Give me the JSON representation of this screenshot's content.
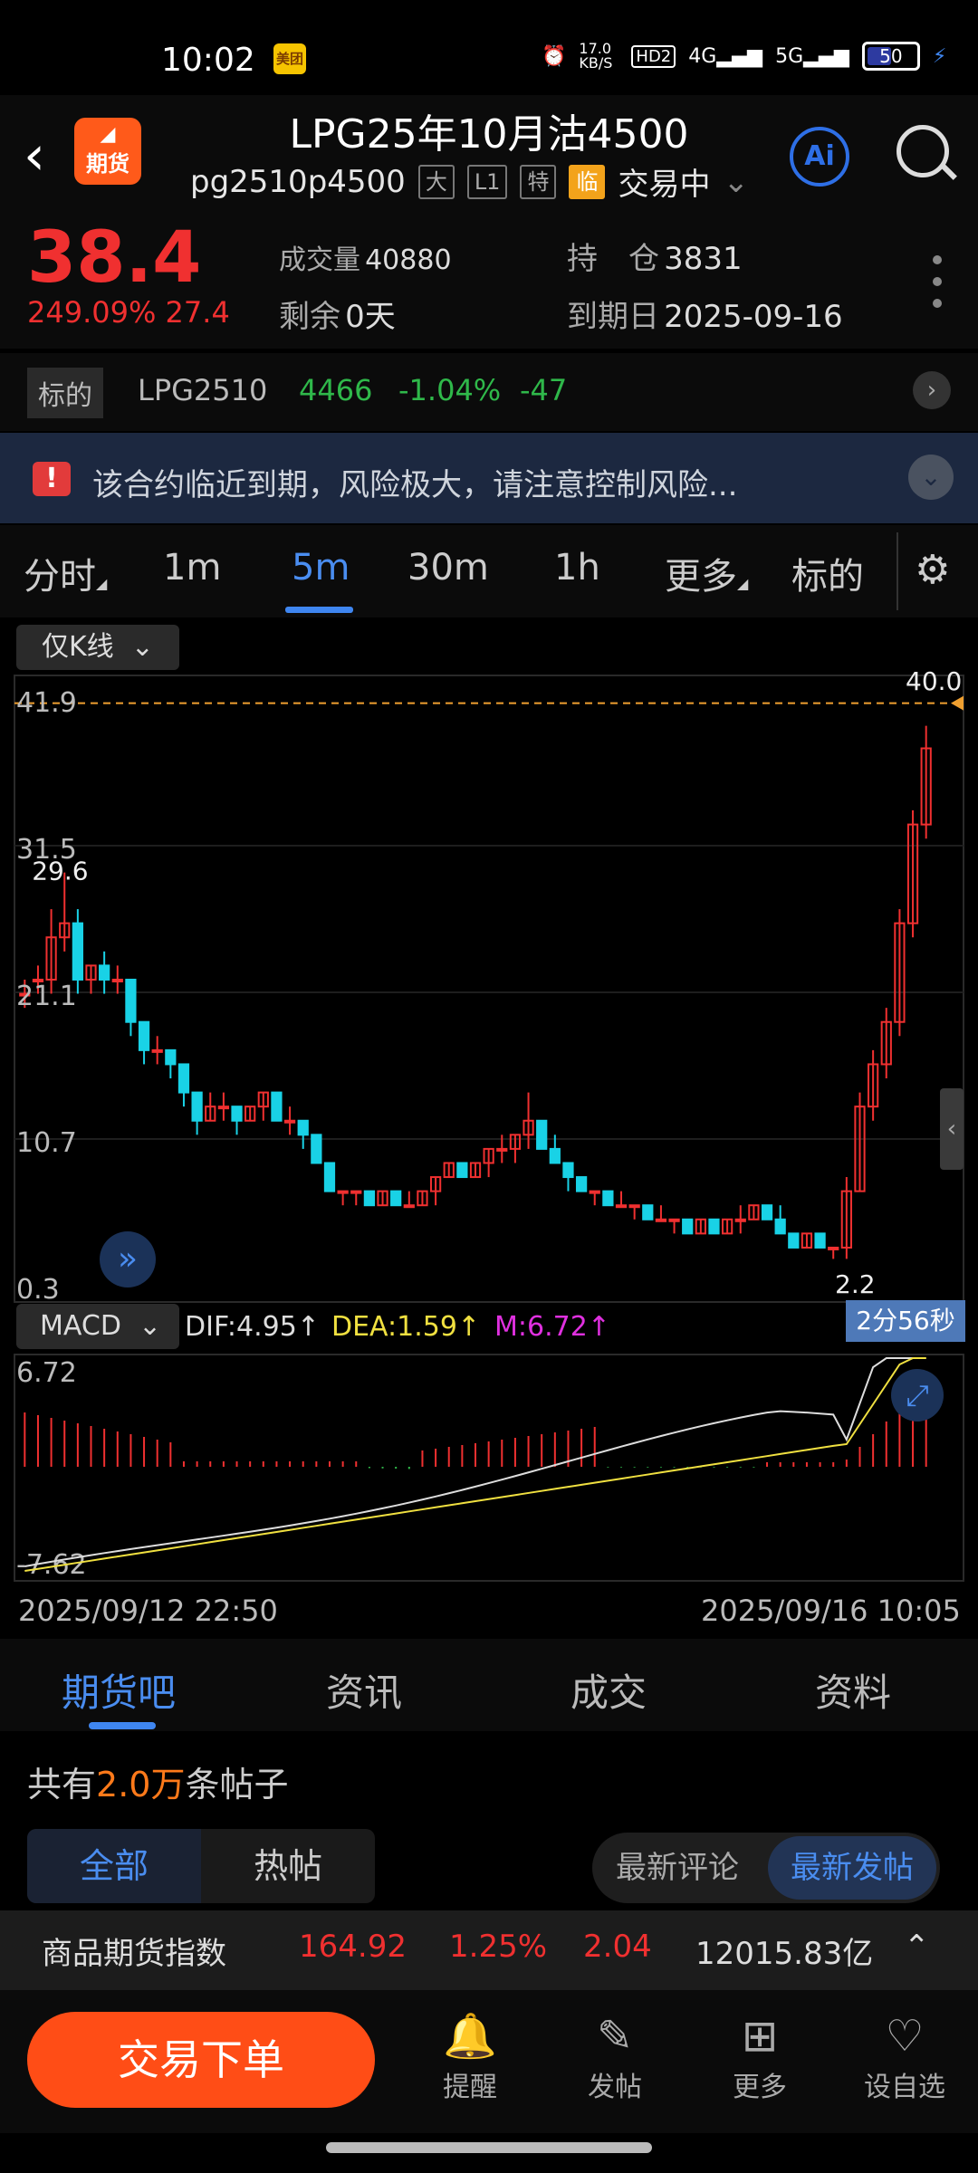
{
  "status": {
    "time": "10:02",
    "app_badge": "美团",
    "speed": "17.0 KB/S",
    "hd": "HD2",
    "net1": "4G",
    "net2": "5G",
    "battery": "50"
  },
  "header": {
    "back": "‹",
    "logo_small": "◢",
    "logo_label": "期货",
    "title": "LPG25年10月沽4500",
    "code": "pg2510p4500",
    "tags": [
      "大",
      "L1",
      "特",
      "临"
    ],
    "state": "交易中",
    "ai": "Ai"
  },
  "quote": {
    "price": "38.4",
    "change_pct": "249.09%",
    "change": "27.4",
    "volume_label": "成交量",
    "volume": "40880",
    "remain_label": "剩余",
    "remain": "0天",
    "oi_label": "持　仓",
    "oi": "3831",
    "expiry_label": "到期日",
    "expiry": "2025-09-16"
  },
  "underlying": {
    "label": "标的",
    "symbol": "LPG2510",
    "price": "4466",
    "pct": "-1.04%",
    "chg": "-47"
  },
  "warning": {
    "text": "该合约临近到期，风险极大，请注意控制风险..."
  },
  "period_tabs": [
    "分时",
    "1m",
    "5m",
    "30m",
    "1h",
    "更多",
    "标的"
  ],
  "active_period": "5m",
  "chart_mode": "仅K线",
  "indicator": {
    "name": "MACD",
    "dif": "DIF:4.95",
    "dea": "DEA:1.59",
    "m": "M:6.72"
  },
  "countdown": "2分56秒",
  "time_start": "2025/09/12 22:50",
  "time_end": "2025/09/16 10:05",
  "chart_data": {
    "type": "candlestick",
    "price_axis": [
      "41.9",
      "31.5",
      "21.1",
      "10.7",
      "0.3"
    ],
    "ylim": [
      0.3,
      41.9
    ],
    "markers": {
      "high": "40.0",
      "left_high": "29.6",
      "low": "2.2"
    },
    "macd_axis": [
      "6.72",
      "-7.62"
    ],
    "candles": [
      [
        21,
        22,
        20,
        21
      ],
      [
        22,
        23,
        21,
        22
      ],
      [
        22,
        27,
        21,
        25
      ],
      [
        25,
        29.6,
        24,
        26
      ],
      [
        26,
        27,
        21,
        22
      ],
      [
        22,
        23,
        21,
        23
      ],
      [
        23,
        24,
        21,
        22
      ],
      [
        22,
        23,
        21,
        22
      ],
      [
        22,
        22,
        18,
        19
      ],
      [
        19,
        19,
        16,
        17
      ],
      [
        17,
        18,
        16,
        17
      ],
      [
        17,
        17,
        15,
        16
      ],
      [
        16,
        16,
        13,
        14
      ],
      [
        14,
        14,
        11,
        12
      ],
      [
        12,
        14,
        12,
        13
      ],
      [
        13,
        14,
        12,
        13
      ],
      [
        13,
        13,
        11,
        12
      ],
      [
        12,
        13,
        12,
        13
      ],
      [
        13,
        14,
        12,
        14
      ],
      [
        14,
        14,
        12,
        12
      ],
      [
        12,
        13,
        11,
        12
      ],
      [
        12,
        12,
        10,
        11
      ],
      [
        11,
        11,
        9,
        9
      ],
      [
        9,
        9,
        7,
        7
      ],
      [
        7,
        7,
        6,
        7
      ],
      [
        7,
        7,
        6,
        7
      ],
      [
        7,
        7,
        6,
        6
      ],
      [
        6,
        7,
        6,
        7
      ],
      [
        7,
        7,
        6,
        6
      ],
      [
        6,
        7,
        6,
        6
      ],
      [
        6,
        7,
        6,
        7
      ],
      [
        7,
        8,
        6,
        8
      ],
      [
        8,
        9,
        8,
        9
      ],
      [
        9,
        9,
        8,
        8
      ],
      [
        8,
        9,
        8,
        9
      ],
      [
        9,
        10,
        8,
        10
      ],
      [
        10,
        11,
        9,
        10
      ],
      [
        10,
        11,
        9,
        11
      ],
      [
        11,
        14,
        10,
        12
      ],
      [
        12,
        12,
        10,
        10
      ],
      [
        10,
        11,
        9,
        9
      ],
      [
        9,
        9,
        7,
        8
      ],
      [
        8,
        8,
        7,
        7
      ],
      [
        7,
        7,
        6,
        7
      ],
      [
        7,
        7,
        6,
        6
      ],
      [
        6,
        7,
        6,
        6
      ],
      [
        6,
        6,
        5,
        6
      ],
      [
        6,
        6,
        5,
        5
      ],
      [
        5,
        6,
        5,
        5
      ],
      [
        5,
        5,
        4,
        5
      ],
      [
        5,
        5,
        4,
        4
      ],
      [
        4,
        5,
        4,
        5
      ],
      [
        5,
        5,
        4,
        4
      ],
      [
        4,
        5,
        4,
        5
      ],
      [
        5,
        6,
        4,
        5
      ],
      [
        5,
        6,
        5,
        6
      ],
      [
        6,
        6,
        5,
        5
      ],
      [
        5,
        6,
        4,
        4
      ],
      [
        4,
        4,
        3,
        3
      ],
      [
        3,
        4,
        3,
        4
      ],
      [
        4,
        4,
        3,
        3
      ],
      [
        3,
        3,
        2.2,
        3
      ],
      [
        3,
        8,
        2.2,
        7
      ],
      [
        7,
        14,
        7,
        13
      ],
      [
        13,
        17,
        12,
        16
      ],
      [
        16,
        20,
        15,
        19
      ],
      [
        19,
        27,
        18,
        26
      ],
      [
        26,
        34,
        25,
        33
      ],
      [
        33,
        40,
        32,
        38.4
      ]
    ]
  },
  "section_tabs": [
    "期货吧",
    "资讯",
    "成交",
    "资料"
  ],
  "posts": {
    "prefix": "共有",
    "count": "2.0万",
    "suffix": "条帖子",
    "seg_all": "全部",
    "seg_hot": "热帖",
    "sort_comment": "最新评论",
    "sort_post": "最新发帖"
  },
  "ticker": {
    "name": "商品期货指数",
    "value": "164.92",
    "pct": "1.25%",
    "chg": "2.04",
    "amount": "12015.83亿"
  },
  "bottom": {
    "order": "交易下单",
    "nav": [
      {
        "icon": "🔔",
        "label": "提醒"
      },
      {
        "icon": "✎",
        "label": "发帖"
      },
      {
        "icon": "⊞",
        "label": "更多"
      },
      {
        "icon": "♡",
        "label": "设自选"
      }
    ]
  },
  "colors": {
    "up": "#f03030",
    "down": "#19d2e6",
    "accent": "#3f86f0",
    "orange": "#ff4d16"
  }
}
